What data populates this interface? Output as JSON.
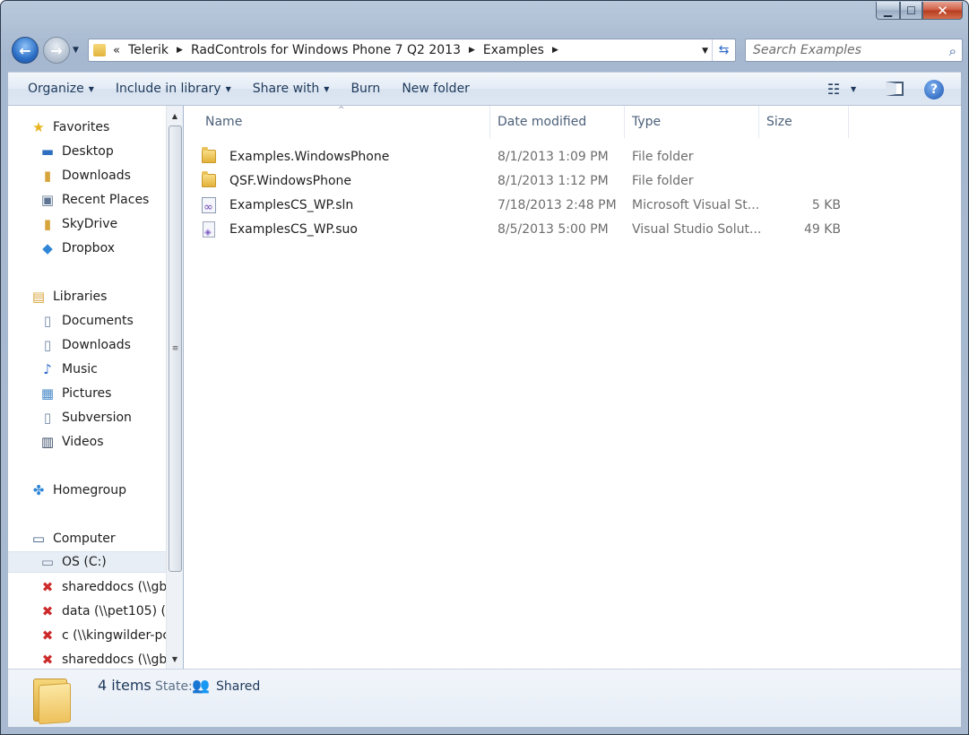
{
  "window": {
    "caption_buttons": {
      "minimize": "▁",
      "maximize": "☐",
      "close": "✕"
    }
  },
  "address": {
    "overflow": "«",
    "crumbs": [
      "Telerik",
      "RadControls for Windows Phone 7 Q2 2013",
      "Examples"
    ],
    "separator": "▶",
    "dropdown": "▼",
    "refresh": "⇆"
  },
  "search": {
    "placeholder": "Search Examples",
    "icon": "⌕"
  },
  "toolbar": {
    "organize": "Organize",
    "include_in_library": "Include in library",
    "share_with": "Share with",
    "burn": "Burn",
    "new_folder": "New folder",
    "caret": "▼",
    "views_icon": "☷",
    "help": "?"
  },
  "nav": {
    "favorites": {
      "label": "Favorites",
      "items": [
        "Desktop",
        "Downloads",
        "Recent Places",
        "SkyDrive",
        "Dropbox"
      ]
    },
    "libraries": {
      "label": "Libraries",
      "items": [
        "Documents",
        "Downloads",
        "Music",
        "Pictures",
        "Subversion",
        "Videos"
      ]
    },
    "homegroup": "Homegroup",
    "computer": {
      "label": "Computer",
      "items": [
        "OS (C:)",
        "shareddocs (\\\\gb",
        "data (\\\\pet105) (\\",
        "c (\\\\kingwilder-pc",
        "shareddocs (\\\\gb"
      ]
    }
  },
  "scrollbar": {
    "up": "▲",
    "down": "▼",
    "grip": "≡"
  },
  "columns": {
    "name": "Name",
    "date_modified": "Date modified",
    "type": "Type",
    "size": "Size",
    "sort_indicator": "^"
  },
  "files": [
    {
      "name": "Examples.WindowsPhone",
      "date": "8/1/2013 1:09 PM",
      "type": "File folder",
      "size": "",
      "icon": "folder-icon"
    },
    {
      "name": "QSF.WindowsPhone",
      "date": "8/1/2013 1:12 PM",
      "type": "File folder",
      "size": "",
      "icon": "folder-icon"
    },
    {
      "name": "ExamplesCS_WP.sln",
      "date": "7/18/2013 2:48 PM",
      "type": "Microsoft Visual St...",
      "size": "5 KB",
      "icon": "visual-studio-solution-icon"
    },
    {
      "name": "ExamplesCS_WP.suo",
      "date": "8/5/2013 5:00 PM",
      "type": "Visual Studio Solut...",
      "size": "49 KB",
      "icon": "visual-studio-suo-icon"
    }
  ],
  "details": {
    "count": "4 items",
    "state_label": "State:",
    "state_value": "Shared"
  }
}
